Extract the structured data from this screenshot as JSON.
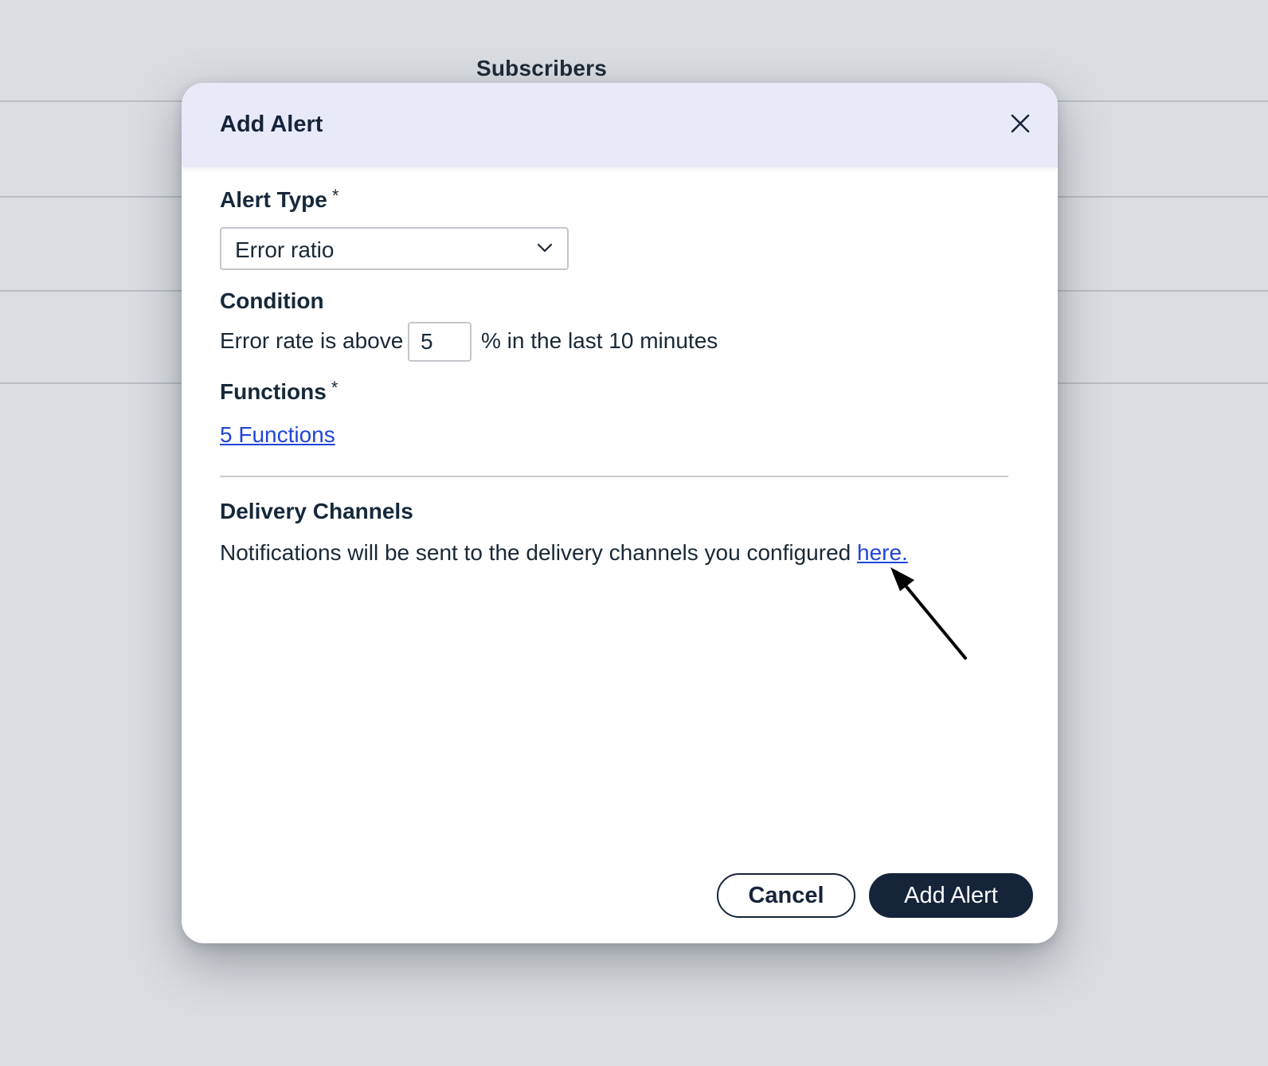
{
  "background": {
    "section_title": "Subscribers"
  },
  "dialog": {
    "title": "Add Alert",
    "close_icon": "close-icon",
    "alert_type": {
      "label": "Alert Type",
      "required_marker": "*",
      "selected_value": "Error ratio",
      "chevron_icon": "chevron-down-icon"
    },
    "condition": {
      "label": "Condition",
      "prefix": "Error rate is above",
      "value": "5",
      "suffix": "% in the last 10 minutes"
    },
    "functions": {
      "label": "Functions",
      "required_marker": "*",
      "link_text": "5 Functions"
    },
    "delivery": {
      "label": "Delivery Channels",
      "text": "Notifications will be sent to the delivery channels you configured",
      "link_text": "here."
    },
    "buttons": {
      "cancel": "Cancel",
      "submit": "Add Alert"
    }
  },
  "colors": {
    "header_bg": "#e8eafa",
    "primary": "#16243a",
    "link": "#2145d6",
    "overlay_bg": "#d9dce1"
  }
}
